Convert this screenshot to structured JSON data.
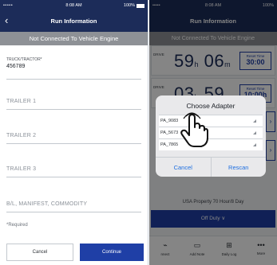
{
  "left": {
    "status": {
      "signal": "•••••",
      "time": "8:08 AM",
      "battery": "100%"
    },
    "nav": {
      "title": "Run Information"
    },
    "banner": "Not Connected To Vehicle Engine",
    "fields": {
      "truck_label": "TRUCK/TRACTOR*",
      "truck_value": "456789",
      "trailer1": "TRAILER 1",
      "trailer2": "TRAILER 2",
      "trailer3": "TRAILER 3",
      "bl": "B/L, MANIFEST, COMMODITY"
    },
    "required": "*Required",
    "buttons": {
      "cancel": "Cancel",
      "continue": "Continue"
    }
  },
  "right": {
    "status": {
      "signal": "•••••",
      "time": "8:08 AM",
      "battery": "100%"
    },
    "nav": {
      "title": "Run Information"
    },
    "banner": "Not Connected To Vehicle Engine",
    "timer1": {
      "side": "DRIVE",
      "hours": "59",
      "hours_unit": "h",
      "mins": "06",
      "mins_unit": "m",
      "reset_label": "Reset Time",
      "reset_value": "30:00"
    },
    "timer2": {
      "side": "DRIVE",
      "hours": "03",
      "hours_unit": "h",
      "mins": "59",
      "mins_unit": "m",
      "reset_label": "Reset Time",
      "reset_value": "10:00h"
    },
    "usa_text": "USA Property 70 Hour/8 Day",
    "off_duty": "Off Duty ∨",
    "tabs": [
      {
        "label": "nnect",
        "icon": "plug-icon"
      },
      {
        "label": "Add Note",
        "icon": "note-icon"
      },
      {
        "label": "Daily Log",
        "icon": "chart-icon"
      },
      {
        "label": "More",
        "icon": "more-icon"
      }
    ],
    "dialog": {
      "title": "Choose Adapter",
      "options": [
        "PA_9083",
        "PA_5673",
        "PA_7865"
      ],
      "cancel": "Cancel",
      "rescan": "Rescan"
    }
  }
}
